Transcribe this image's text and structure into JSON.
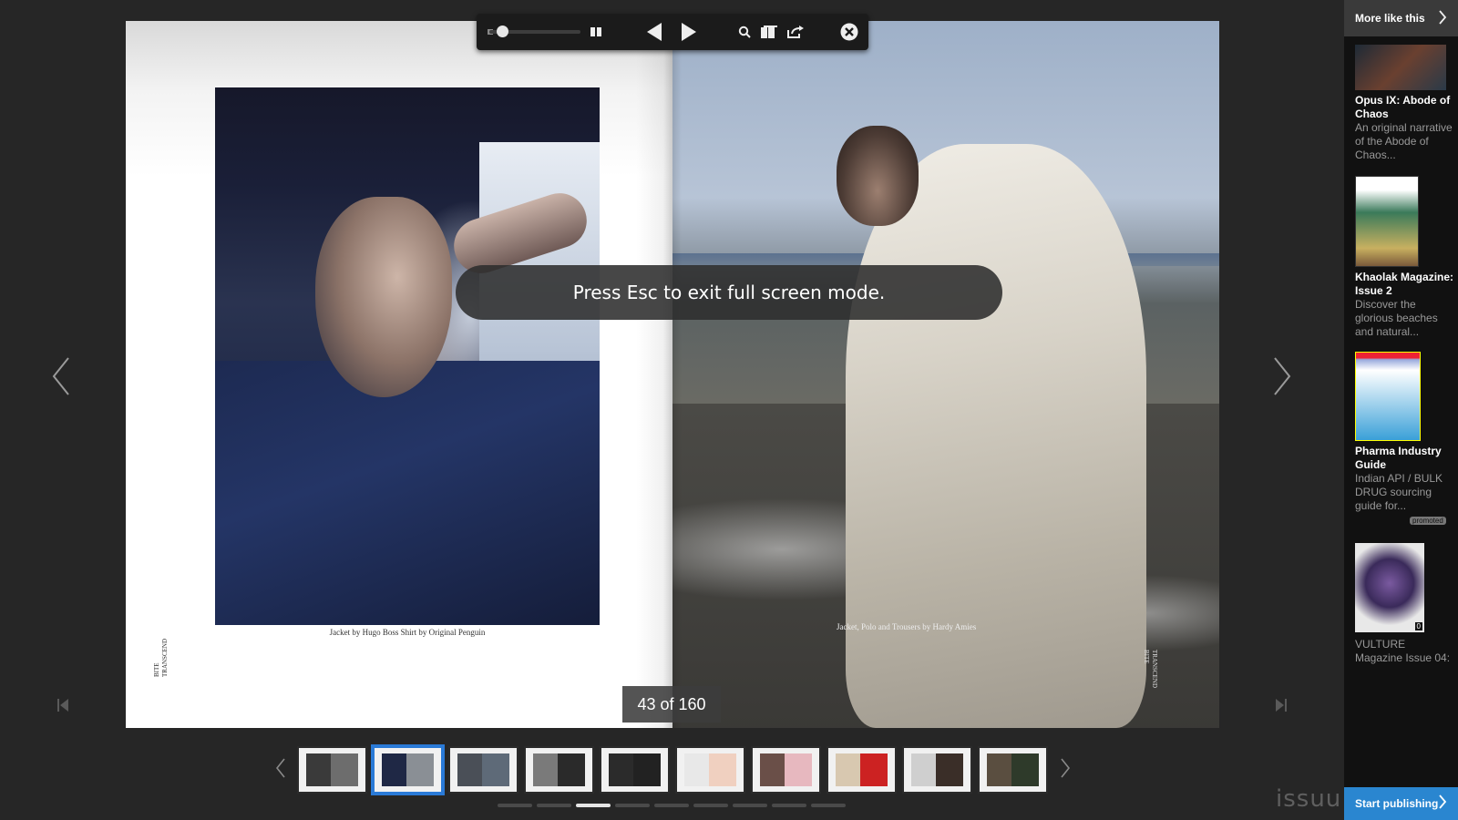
{
  "toolbar": {
    "icons": [
      "zoom-slider",
      "grid-icon",
      "prev-icon",
      "next-icon",
      "search-icon",
      "pages-icon",
      "share-icon",
      "close-icon"
    ]
  },
  "toast": {
    "text": "Press Esc to exit full screen mode."
  },
  "spread": {
    "left_caption": "Jacket by Hugo Boss   Shirt by Original Penguin",
    "right_caption": "Jacket, Polo and Trousers by Hardy Amies",
    "spine_left": "BITE\nTRANSCEND",
    "spine_right": "TRANSCEND\nBITE"
  },
  "counter": {
    "text": "43 of 160"
  },
  "sidebar": {
    "header": "More like this",
    "items": [
      {
        "title": "Opus IX: Abode of Chaos",
        "desc": "An original narrative of the Abode of Chaos..."
      },
      {
        "title": "Khaolak Magazine: Issue 2",
        "desc": "Discover the glorious beaches and natural..."
      },
      {
        "title": "Pharma Industry Guide",
        "desc": "Indian API / BULK DRUG sourcing guide for...",
        "badge": "promoted"
      },
      {
        "title": "",
        "desc": "VULTURE Magazine Issue 04:",
        "badge_count": "0"
      }
    ],
    "cta": "Start publishing"
  },
  "brand": {
    "logo": "issuu"
  },
  "thumbnails": {
    "count": 10,
    "active_index": 1
  },
  "pager_dots": {
    "count": 9,
    "active_index": 2
  },
  "colors": {
    "accent": "#2a86d0",
    "background": "#262626"
  }
}
